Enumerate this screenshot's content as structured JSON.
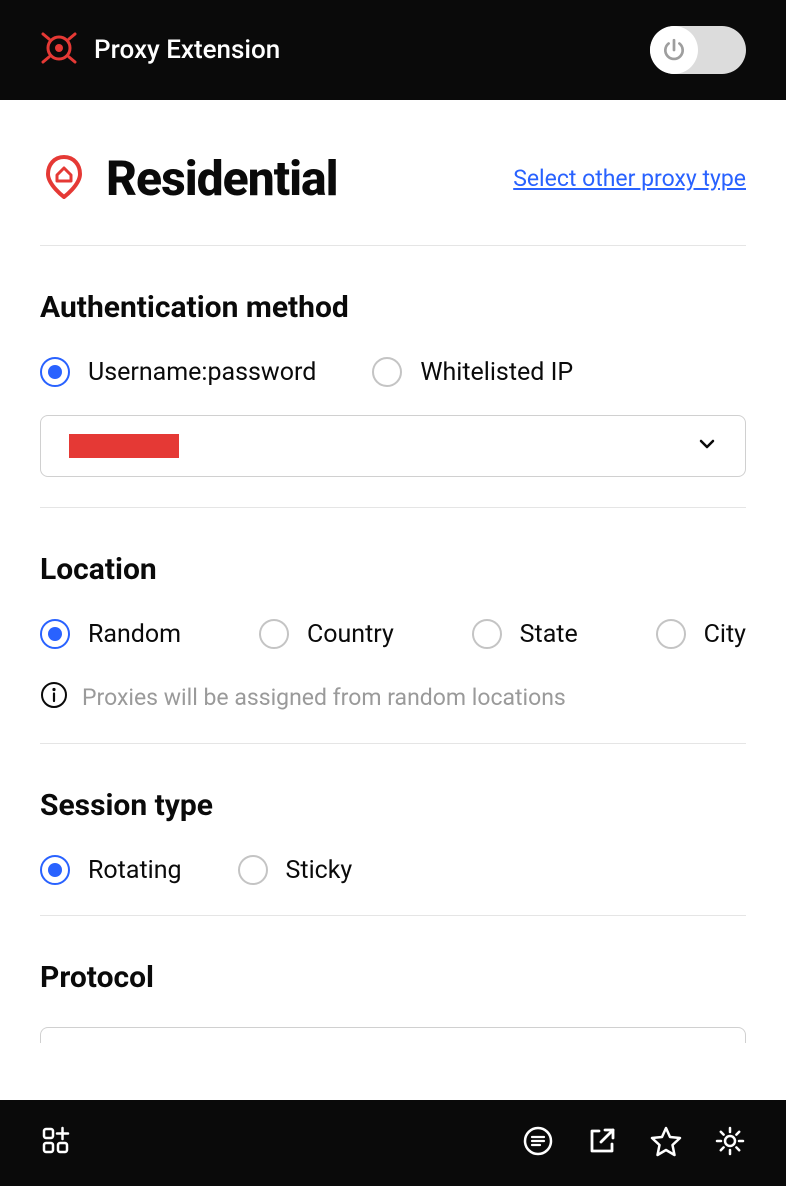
{
  "header": {
    "title": "Proxy Extension",
    "toggle_enabled": false
  },
  "page": {
    "title": "Residential",
    "select_other_label": "Select other proxy type"
  },
  "auth": {
    "title": "Authentication method",
    "options": [
      {
        "label": "Username:password",
        "selected": true
      },
      {
        "label": "Whitelisted IP",
        "selected": false
      }
    ],
    "selected_credential": "(redacted)"
  },
  "location": {
    "title": "Location",
    "options": [
      {
        "label": "Random",
        "selected": true
      },
      {
        "label": "Country",
        "selected": false
      },
      {
        "label": "State",
        "selected": false
      },
      {
        "label": "City",
        "selected": false
      }
    ],
    "info": "Proxies will be assigned from random locations"
  },
  "session": {
    "title": "Session type",
    "options": [
      {
        "label": "Rotating",
        "selected": true
      },
      {
        "label": "Sticky",
        "selected": false
      }
    ]
  },
  "protocol": {
    "title": "Protocol"
  },
  "colors": {
    "accent": "#e53935",
    "link": "#2962ff",
    "header_bg": "#0a0a0a"
  }
}
